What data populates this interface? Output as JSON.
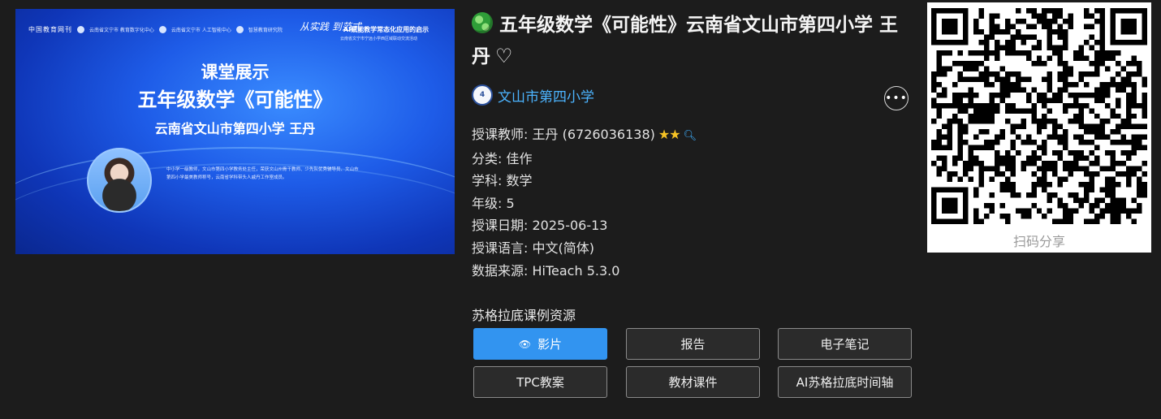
{
  "thumbnail": {
    "brand": "中国教育网刊",
    "logo_labels": [
      "云南省文宁市 教育数字化中心",
      "云南省文宁市 人工智能中心",
      "智慧教育研究院"
    ],
    "slogan_main": "从实践 到范式",
    "slogan_title": "AI赋能教学常态化应用的启示",
    "slogan_sub": "云南省文宁市宁远小学西区域联动交流活动",
    "heading": "课堂展示",
    "lesson": "五年级数学《可能性》",
    "teacher_line": "云南省文山市第四小学  王丹",
    "bio": "中小学一级教师，文山市第四小学教务处主任，荣获文山州骨干教师、少先队优秀辅导员、文山市第四小学最美教师称号，云南省学科带头人戚丹工作室成员。"
  },
  "title": "五年级数学《可能性》云南省文山市第四小学 王丹",
  "heart_glyph": "♡",
  "school": {
    "logo_text": "4",
    "name": "文山市第四小学"
  },
  "more_glyph": "•••",
  "meta": [
    {
      "key": "授课教师",
      "value": "王丹 (6726036138)"
    },
    {
      "key": "分类",
      "value": "佳作"
    },
    {
      "key": "学科",
      "value": "数学"
    },
    {
      "key": "年级",
      "value": "5"
    },
    {
      "key": "授课日期",
      "value": "2025-06-13"
    },
    {
      "key": "授课语言",
      "value": "中文(简体)"
    },
    {
      "key": "数据来源",
      "value": "HiTeach 5.3.0"
    }
  ],
  "stars": "★★",
  "search_glyph": "🔍︎",
  "resources": {
    "title": "苏格拉底课例资源",
    "buttons": [
      "影片",
      "报告",
      "电子笔记",
      "TPC教案",
      "教材课件",
      "AI苏格拉底时间轴"
    ],
    "eye_glyph": "👁"
  },
  "qr": {
    "caption": "扫码分享"
  },
  "colors": {
    "primary": "#3294f0",
    "link": "#4cb4ff",
    "star": "#f6c324",
    "background": "#1c1c1c"
  }
}
